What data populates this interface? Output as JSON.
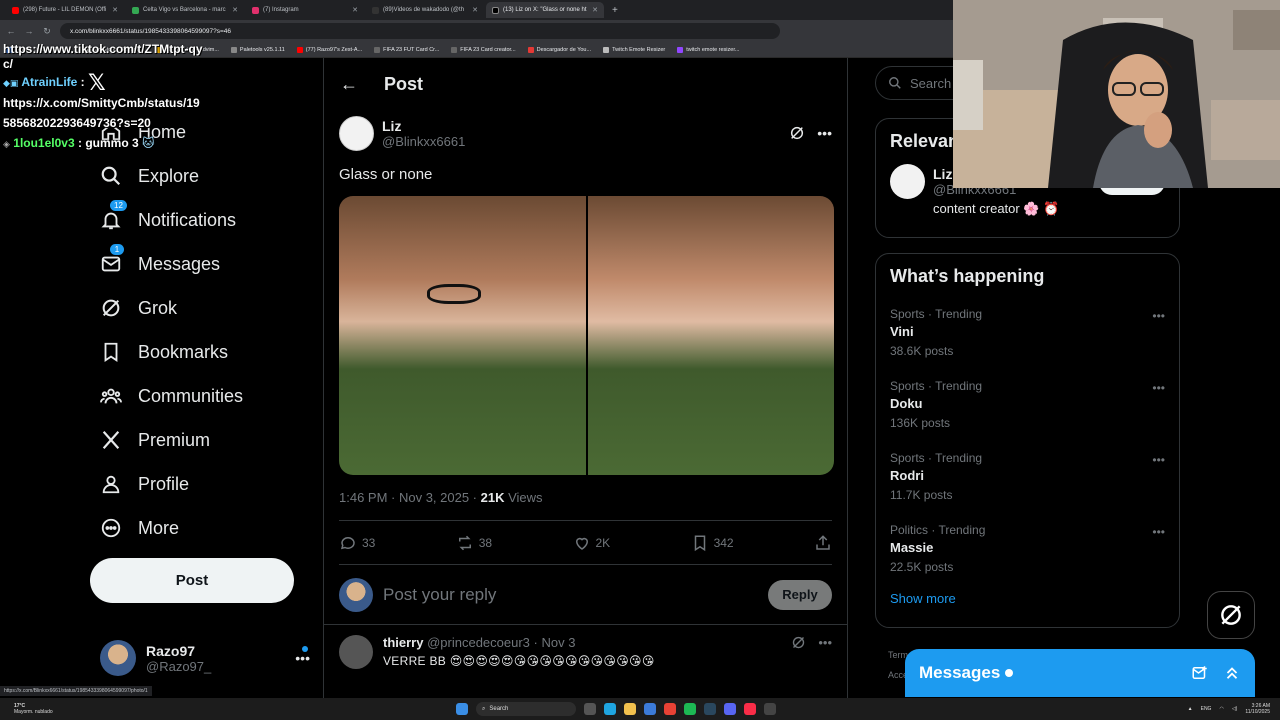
{
  "browser": {
    "tabs": [
      {
        "label": "(298) Future - LIL DEMON (Offi",
        "color": "#ff0000"
      },
      {
        "label": "Celta Vigo vs Barcelona - marc",
        "color": "#34a853"
      },
      {
        "label": "(7) Instagram",
        "color": "#e1306c"
      },
      {
        "label": "(89)Videos de wakadodo (@th",
        "color": "#111111"
      },
      {
        "label": "(13) Liz on X: \"Glass or none ht",
        "color": "#000000",
        "active": true
      }
    ],
    "url": "x.com/blinkxx6661/status/1985433398064599097?s=46",
    "bookmarks": [
      "Build a Triviaz - Tesly...",
      "App Store / Streaml...",
      "SongTrivia2 - Advim...",
      "Paletools v25.1.11",
      "(77) Razo97's Zest-A...",
      "FIFA 23 FUT Card Cr...",
      "FIFA 23 Card creator...",
      "Descargador de You...",
      "Twitch Emote Resizer",
      "twitch emote resizer..."
    ]
  },
  "chat": {
    "line0": "https://www.tiktok.com/t/ZTMtpt-qy",
    "line1": "c/",
    "user1": "AtrainLife",
    "line2": "https://x.com/SmittyCmb/status/19",
    "line3": "58568202293649736?s=20",
    "user2": "1lou1el0v3",
    "msg2": "gummo 3"
  },
  "nav": {
    "items": [
      {
        "label": "Home",
        "icon": "home-icon"
      },
      {
        "label": "Explore",
        "icon": "search-icon"
      },
      {
        "label": "Notifications",
        "icon": "bell-icon",
        "badge": "12"
      },
      {
        "label": "Messages",
        "icon": "envelope-icon",
        "badge": "1"
      },
      {
        "label": "Grok",
        "icon": "grok-icon"
      },
      {
        "label": "Bookmarks",
        "icon": "bookmark-icon"
      },
      {
        "label": "Communities",
        "icon": "people-icon"
      },
      {
        "label": "Premium",
        "icon": "x-logo-icon"
      },
      {
        "label": "Profile",
        "icon": "person-icon"
      },
      {
        "label": "More",
        "icon": "more-circle-icon"
      }
    ],
    "post_label": "Post",
    "account": {
      "name": "Razo97",
      "handle": "@Razo97_"
    }
  },
  "post": {
    "header": "Post",
    "author_name": "Liz",
    "author_handle": "@Blinkxx6661",
    "text": "Glass or none",
    "timestamp": "1:46 PM · Nov 3, 2025 · ",
    "views_count": "21K",
    "views_label": " Views",
    "stats": {
      "replies": "33",
      "reposts": "38",
      "likes": "2K",
      "bookmarks": "342"
    },
    "reply_placeholder": "Post your reply",
    "reply_button": "Reply"
  },
  "comment": {
    "name": "thierry",
    "handle": "@princedecoeur3 · Nov 3",
    "text": "VERRE BB 😍😍😍😍😍😘😘😘😘😘😘😘😘😘😘😘"
  },
  "right": {
    "search_placeholder": "Search",
    "relevant_title": "Relevan",
    "relevant_user": {
      "name": "Liz",
      "handle": "@Blinkxx6661",
      "bio": "content creator 🌸 ⏰",
      "follow_label": "Follow"
    },
    "happening_title": "What’s happening",
    "trends": [
      {
        "category": "Sports · Trending",
        "name": "Vini",
        "posts": "38.6K posts"
      },
      {
        "category": "Sports · Trending",
        "name": "Doku",
        "posts": "136K posts"
      },
      {
        "category": "Sports · Trending",
        "name": "Rodri",
        "posts": "11.7K posts"
      },
      {
        "category": "Politics · Trending",
        "name": "Massie",
        "posts": "22.5K posts"
      }
    ],
    "show_more": "Show more",
    "footer1": "Term",
    "footer2": "Acce"
  },
  "messages_drawer": {
    "title": "Messages"
  },
  "taskbar": {
    "status_url": "https://x.com/Blinkxx6661/status/1985433398064599097/photo/1",
    "weather_temp": "17°C",
    "weather_desc": "Mayorm. nublado",
    "search": "Search",
    "lang": "ENG",
    "time": "3:26 AM",
    "date": "11/10/2025"
  },
  "colors": {
    "accent": "#1d9bf0",
    "bg": "#000000",
    "border": "#2f3336",
    "muted": "#71767b"
  }
}
